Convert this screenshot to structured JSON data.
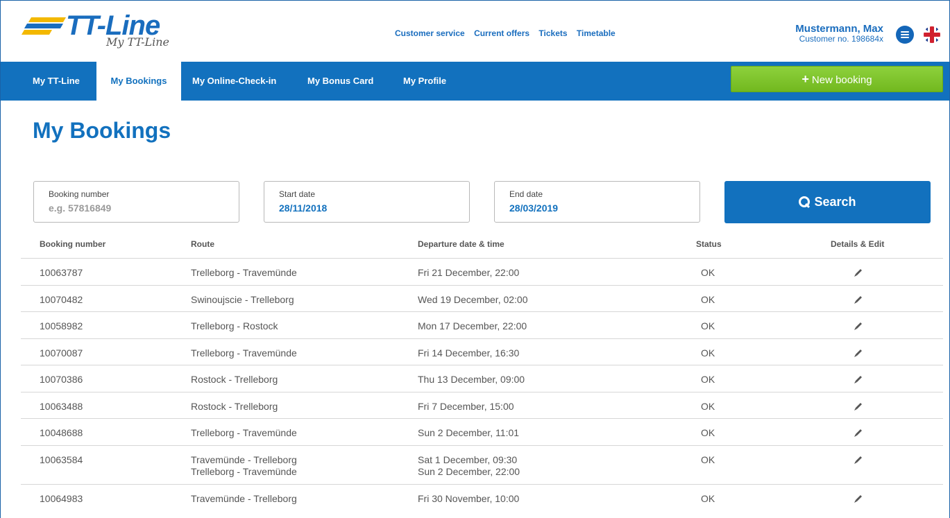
{
  "header": {
    "logo_text": "TT-Line",
    "logo_sub": "My TT-Line",
    "links": [
      "Customer service",
      "Current offers",
      "Tickets",
      "Timetable"
    ],
    "user_name": "Mustermann, Max",
    "customer_no": "Customer no. 198684x"
  },
  "nav": {
    "items": [
      "My TT-Line",
      "My Bookings",
      "My Online-Check-in",
      "My Bonus Card",
      "My Profile"
    ],
    "active": "My Bookings",
    "new_booking_label": "New booking"
  },
  "page": {
    "title": "My Bookings"
  },
  "search": {
    "booking_number_label": "Booking number",
    "booking_number_placeholder": "e.g. 57816849",
    "start_date_label": "Start date",
    "start_date_value": "28/11/2018",
    "end_date_label": "End date",
    "end_date_value": "28/03/2019",
    "button_label": "Search"
  },
  "table": {
    "headers": [
      "Booking number",
      "Route",
      "Departure date & time",
      "Status",
      "Details & Edit"
    ],
    "rows": [
      {
        "number": "10063787",
        "route": [
          "Trelleborg - Travemünde"
        ],
        "departure": [
          "Fri 21 December, 22:00"
        ],
        "status": "OK"
      },
      {
        "number": "10070482",
        "route": [
          "Swinoujscie - Trelleborg"
        ],
        "departure": [
          "Wed 19 December, 02:00"
        ],
        "status": "OK"
      },
      {
        "number": "10058982",
        "route": [
          "Trelleborg - Rostock"
        ],
        "departure": [
          "Mon 17 December, 22:00"
        ],
        "status": "OK"
      },
      {
        "number": "10070087",
        "route": [
          "Trelleborg - Travemünde"
        ],
        "departure": [
          "Fri 14 December, 16:30"
        ],
        "status": "OK"
      },
      {
        "number": "10070386",
        "route": [
          "Rostock - Trelleborg"
        ],
        "departure": [
          "Thu 13 December, 09:00"
        ],
        "status": "OK"
      },
      {
        "number": "10063488",
        "route": [
          "Rostock - Trelleborg"
        ],
        "departure": [
          "Fri 7 December, 15:00"
        ],
        "status": "OK"
      },
      {
        "number": "10048688",
        "route": [
          "Trelleborg - Travemünde"
        ],
        "departure": [
          "Sun 2 December, 11:01"
        ],
        "status": "OK"
      },
      {
        "number": "10063584",
        "route": [
          "Travemünde - Trelleborg",
          "Trelleborg - Travemünde"
        ],
        "departure": [
          "Sat 1 December, 09:30",
          "Sun 2 December, 22:00"
        ],
        "status": "OK"
      },
      {
        "number": "10064983",
        "route": [
          "Travemünde - Trelleborg"
        ],
        "departure": [
          "Fri 30 November, 10:00"
        ],
        "status": "OK"
      }
    ]
  },
  "colors": {
    "brand_blue": "#1271be",
    "accent_green": "#7cc42b",
    "logo_yellow": "#f3b800"
  },
  "icons": {
    "menu": "menu-icon",
    "language": "uk-flag-icon",
    "edit": "pencil-icon",
    "search": "search-icon",
    "plus": "plus-icon"
  }
}
